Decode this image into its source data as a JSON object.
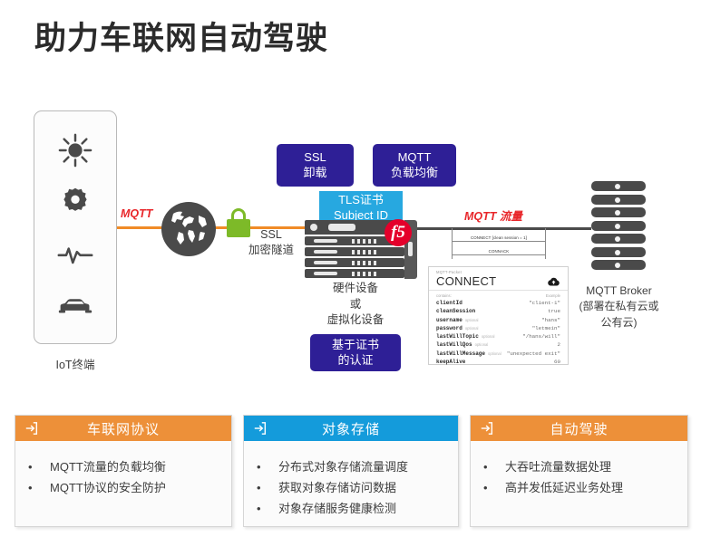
{
  "title": "助力车联网自动驾驶",
  "colors": {
    "purple": "#2E1F96",
    "blue": "#27A8E0",
    "orange": "#ED9039",
    "red": "#E8262A",
    "green": "#7DBA28",
    "f5_red": "#E4002B",
    "dark_gray": "#4A4A4A"
  },
  "iot": {
    "label": "IoT终端",
    "icons": [
      "sun-icon",
      "gear-icon",
      "pulse-icon",
      "car-icon"
    ]
  },
  "links": {
    "mqtt_left_label": "MQTT",
    "mqtt_flow_label": "MQTT 流量",
    "ssl_tunnel_label": "SSL\n加密隧道",
    "ssl_tunnel_line1": "SSL",
    "ssl_tunnel_line2": "加密隧道"
  },
  "callouts": {
    "ssl_offload_line1": "SSL",
    "ssl_offload_line2": "卸载",
    "mqtt_lb_line1": "MQTT",
    "mqtt_lb_line2": "负载均衡",
    "tls_cert_line1": "TLS证书",
    "tls_cert_line2": "Subject ID",
    "cert_auth_line1": "基于证书",
    "cert_auth_line2": "的认证"
  },
  "appliance": {
    "brand": "f5",
    "label_line1": "硬件设备",
    "label_line2": "或",
    "label_line3": "虚拟化设备"
  },
  "broker": {
    "unit_count": 7,
    "label_line1": "MQTT Broker",
    "label_line2": "(部署在私有云或",
    "label_line3": "公有云)"
  },
  "sequence": {
    "msg_request": "CONNECT [clean session = 1]",
    "msg_response": "CONNACK"
  },
  "packet": {
    "kind": "MQTT-Packet",
    "title": "CONNECT",
    "col_contains": "contains:",
    "col_example": "Example",
    "rows": [
      {
        "key": "clientId",
        "optional": "",
        "value": "\"client-1\""
      },
      {
        "key": "cleanSession",
        "optional": "",
        "value": "true"
      },
      {
        "key": "username",
        "optional": "optional",
        "value": "\"hans\""
      },
      {
        "key": "password",
        "optional": "optional",
        "value": "\"letmein\""
      },
      {
        "key": "lastWillTopic",
        "optional": "optional",
        "value": "\"/hans/will\""
      },
      {
        "key": "lastWillQos",
        "optional": "optional",
        "value": "2"
      },
      {
        "key": "lastWillMessage",
        "optional": "optional",
        "value": "\"unexpected exit\""
      },
      {
        "key": "keepAlive",
        "optional": "",
        "value": "60"
      }
    ]
  },
  "panels": [
    {
      "title": "车联网协议",
      "header_color": "#ED9039",
      "icon": "enter-arrow-icon",
      "bullets": [
        "MQTT流量的负载均衡",
        "MQTT协议的安全防护"
      ]
    },
    {
      "title": "对象存储",
      "header_color": "#149BDB",
      "icon": "enter-arrow-icon",
      "bullets": [
        "分布式对象存储流量调度",
        "获取对象存储访问数据",
        "对象存储服务健康检测"
      ]
    },
    {
      "title": "自动驾驶",
      "header_color": "#ED9039",
      "icon": "enter-arrow-icon",
      "bullets": [
        "大吞吐流量数据处理",
        "高并发低延迟业务处理"
      ]
    }
  ],
  "bullet_char": "•"
}
